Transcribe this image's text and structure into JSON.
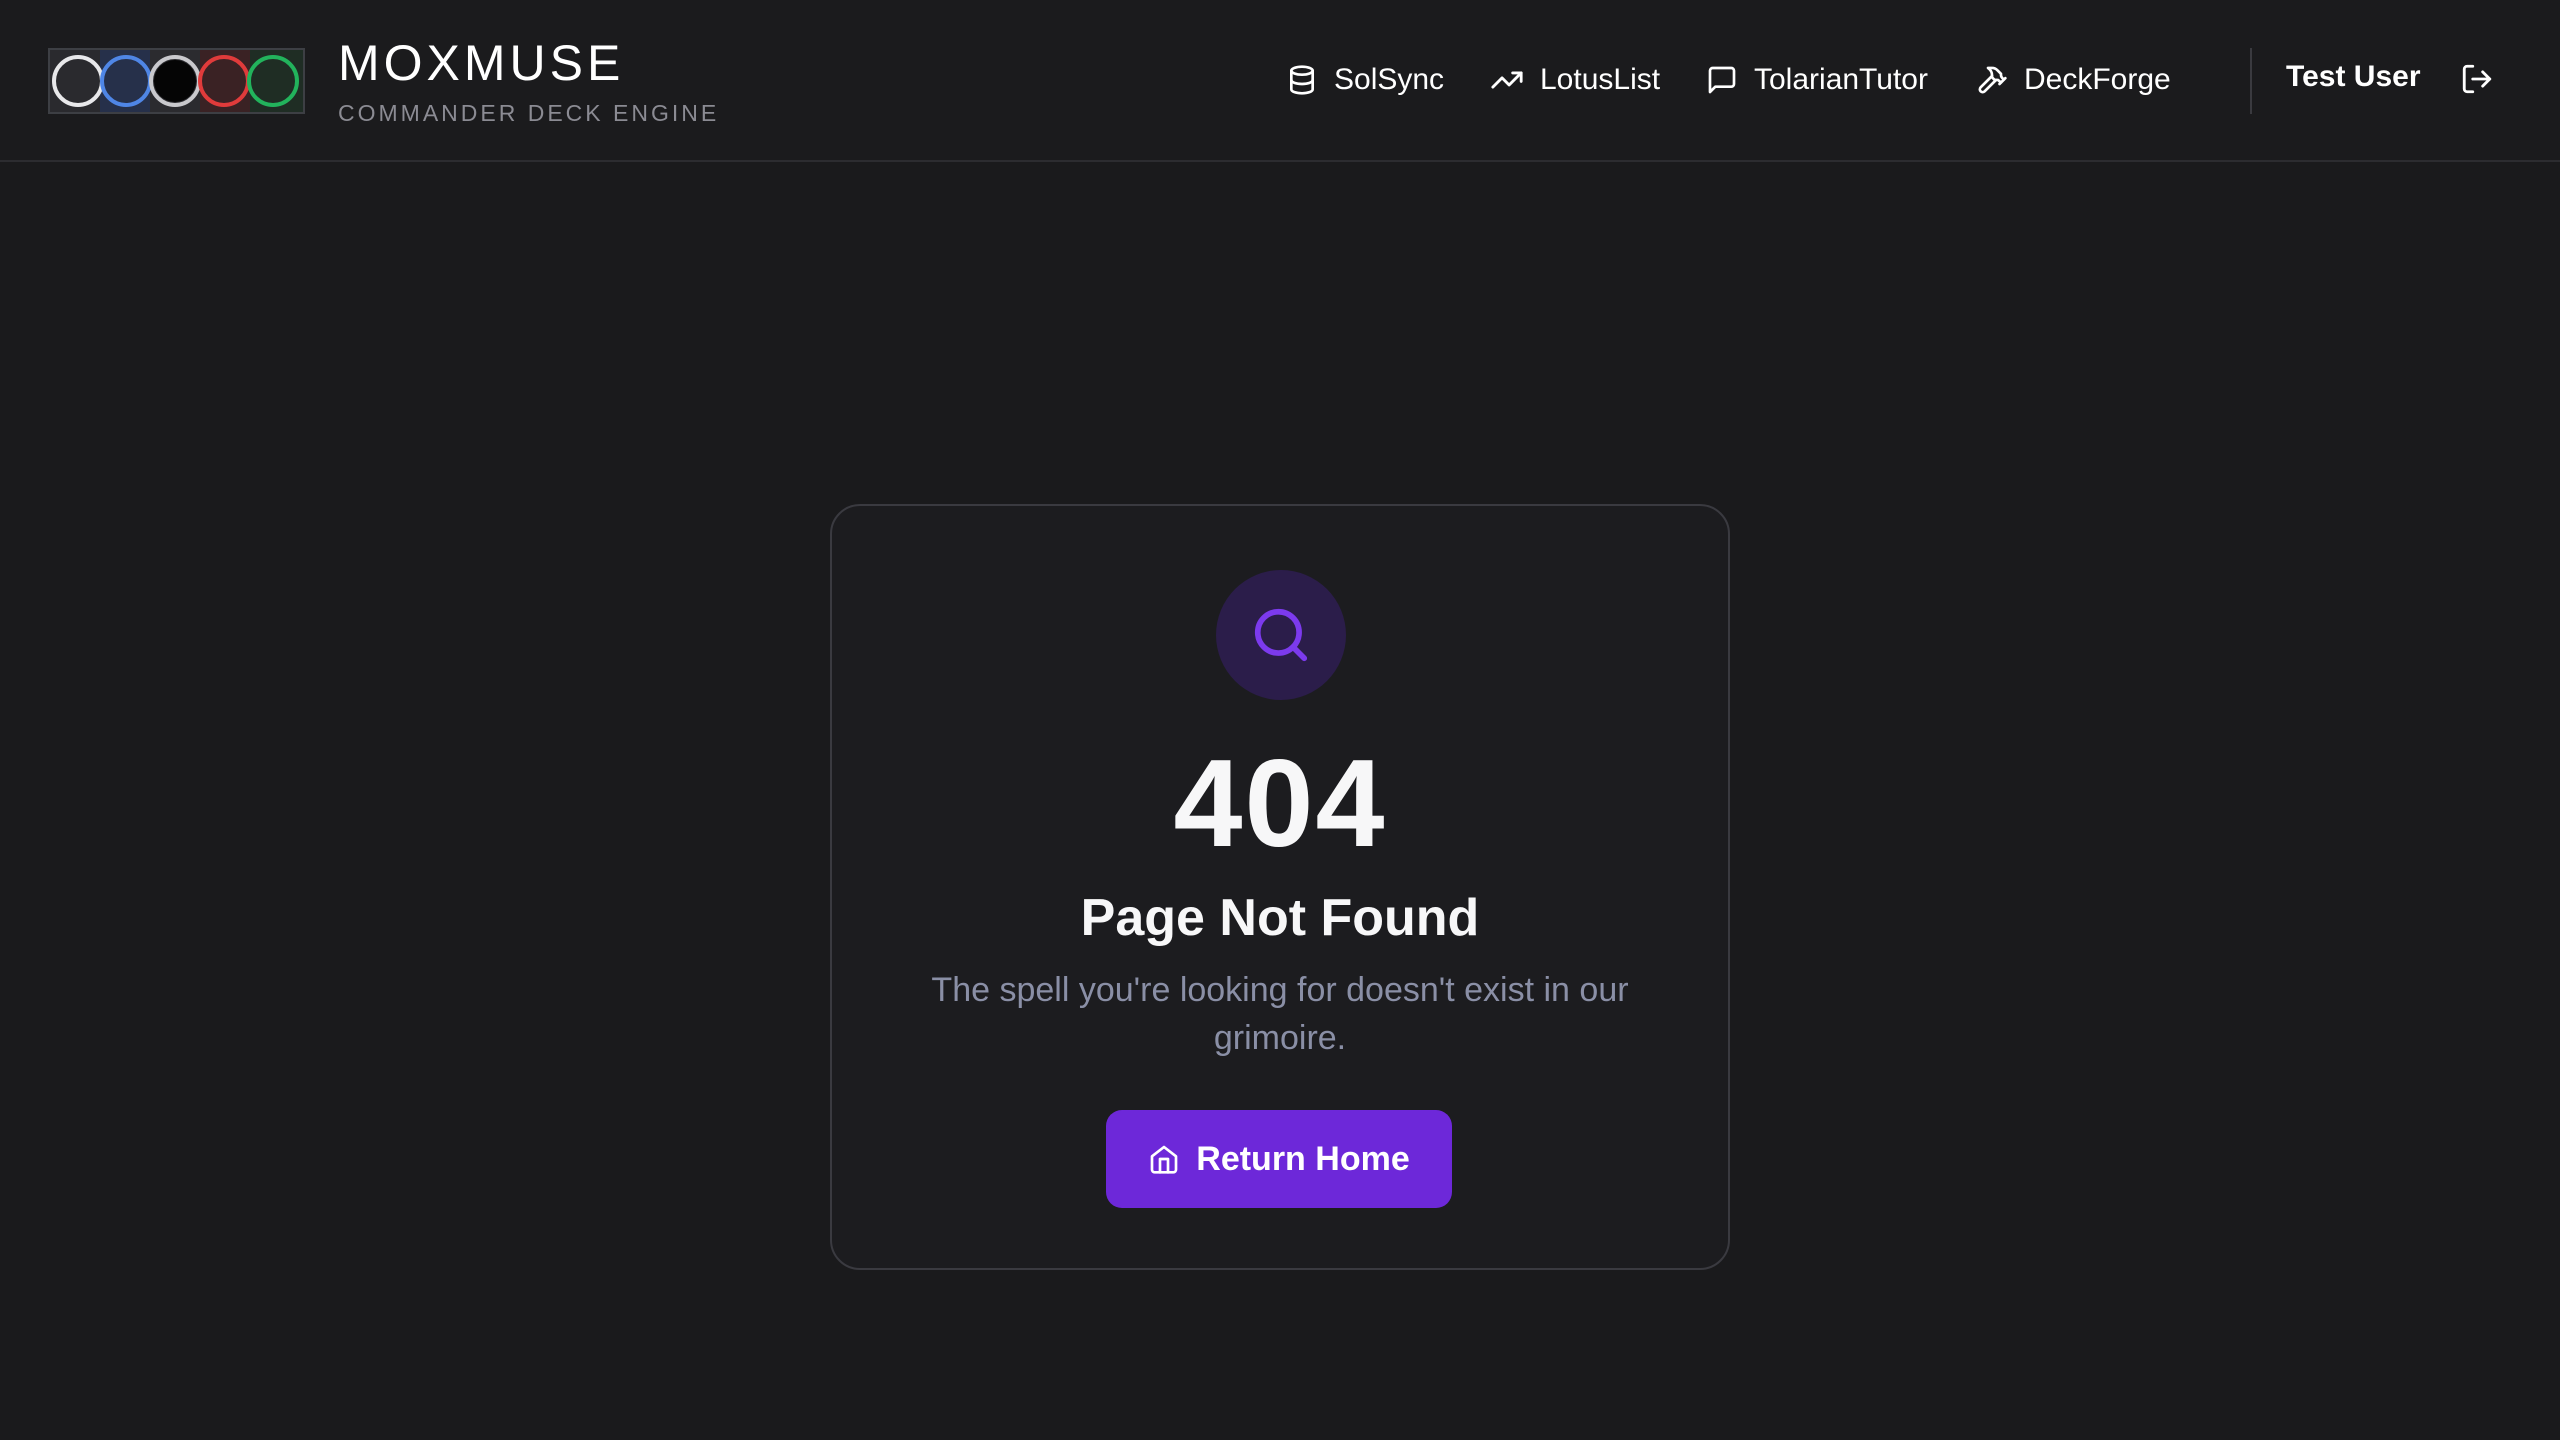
{
  "header": {
    "brand": {
      "title": "MOXMUSE",
      "subtitle": "COMMANDER DECK ENGINE",
      "mana_colors": [
        "#e8e8ea",
        "#4f86e6",
        "#000000",
        "#e03b3b",
        "#22b35c"
      ]
    },
    "nav": [
      {
        "label": "SolSync",
        "icon": "database-icon"
      },
      {
        "label": "LotusList",
        "icon": "trending-up-icon"
      },
      {
        "label": "TolarianTutor",
        "icon": "message-square-icon"
      },
      {
        "label": "DeckForge",
        "icon": "hammer-icon"
      }
    ],
    "user": {
      "name": "Test User",
      "logout_icon": "log-out-icon"
    }
  },
  "main": {
    "icon": "search-icon",
    "code": "404",
    "title": "Page Not Found",
    "message": "The spell you're looking for doesn't exist in our grimoire.",
    "button": {
      "label": "Return Home",
      "icon": "home-icon"
    }
  },
  "colors": {
    "background": "#1a1a1c",
    "accent": "#6d28d9",
    "accent_light": "#7c3aed",
    "icon_circle": "#2b1d4a",
    "muted_text": "#8a8fa6"
  }
}
